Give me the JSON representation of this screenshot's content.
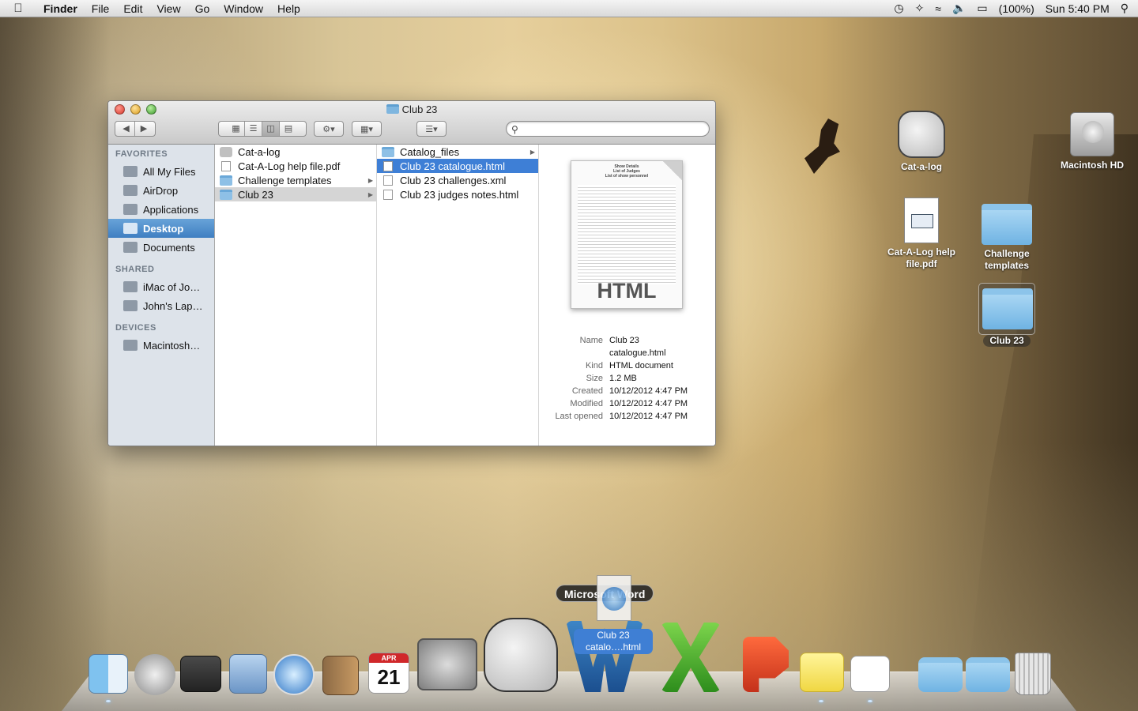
{
  "menubar": {
    "apple": "",
    "items": [
      "Finder",
      "File",
      "Edit",
      "View",
      "Go",
      "Window",
      "Help"
    ],
    "battery": "(100%)",
    "clock": "Sun 5:40 PM"
  },
  "window": {
    "title": "Club 23",
    "sidebar": {
      "favorites_header": "FAVORITES",
      "favorites": [
        "All My Files",
        "AirDrop",
        "Applications",
        "Desktop",
        "Documents"
      ],
      "shared_header": "SHARED",
      "shared": [
        "iMac of Jo…",
        "John's Lap…"
      ],
      "devices_header": "DEVICES",
      "devices": [
        "Macintosh…"
      ]
    },
    "column1": [
      "Cat-a-log",
      "Cat-A-Log help file.pdf",
      "Challenge templates",
      "Club 23"
    ],
    "column2": [
      "Catalog_files",
      "Club 23 catalogue.html",
      "Club 23 challenges.xml",
      "Club 23 judges notes.html"
    ],
    "preview": {
      "doc_header": "Show Details\nList of Judges\nList of show personnel",
      "doc_label": "HTML",
      "info": [
        {
          "k": "Name",
          "v": "Club 23 catalogue.html"
        },
        {
          "k": "Kind",
          "v": "HTML document"
        },
        {
          "k": "Size",
          "v": "1.2 MB"
        },
        {
          "k": "Created",
          "v": "10/12/2012 4:47 PM"
        },
        {
          "k": "Modified",
          "v": "10/12/2012 4:47 PM"
        },
        {
          "k": "Last opened",
          "v": "10/12/2012 4:47 PM"
        }
      ]
    }
  },
  "desktop": {
    "icons": {
      "catalog": "Cat-a-log",
      "hd": "Macintosh HD",
      "pdf": "Cat-A-Log help file.pdf",
      "challenge": "Challenge templates",
      "club": "Club 23"
    }
  },
  "dock": {
    "drag_tooltip": "Microsoft Word",
    "drag_name": "Club 23 catalo….html",
    "calendar_month": "APR",
    "calendar_day": "21"
  },
  "colors": {
    "selection_blue": "#3e7fd6",
    "sidebar_bg": "#dde3ea"
  }
}
